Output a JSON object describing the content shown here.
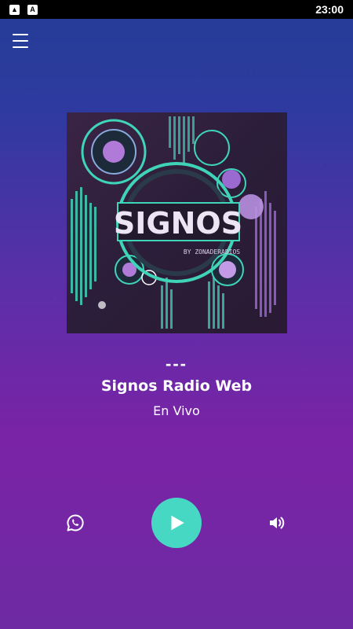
{
  "statusbar": {
    "icons": [
      "image-icon",
      "a-letter-icon"
    ],
    "icon_a_label": "A",
    "time": "23:00"
  },
  "header": {
    "menu_icon": "hamburger-menu-icon"
  },
  "artwork": {
    "logo_text": "SIGNOS",
    "logo_sub": "BY ZONADERADIOS"
  },
  "now_playing": {
    "track": "---",
    "station": "Signos Radio Web",
    "status": "En Vivo"
  },
  "controls": {
    "share_icon": "whatsapp-icon",
    "play_icon": "play-icon",
    "volume_icon": "volume-icon"
  },
  "colors": {
    "accent": "#47d8c4",
    "bg_top": "#233d96",
    "bg_bottom": "#7a23a6"
  }
}
